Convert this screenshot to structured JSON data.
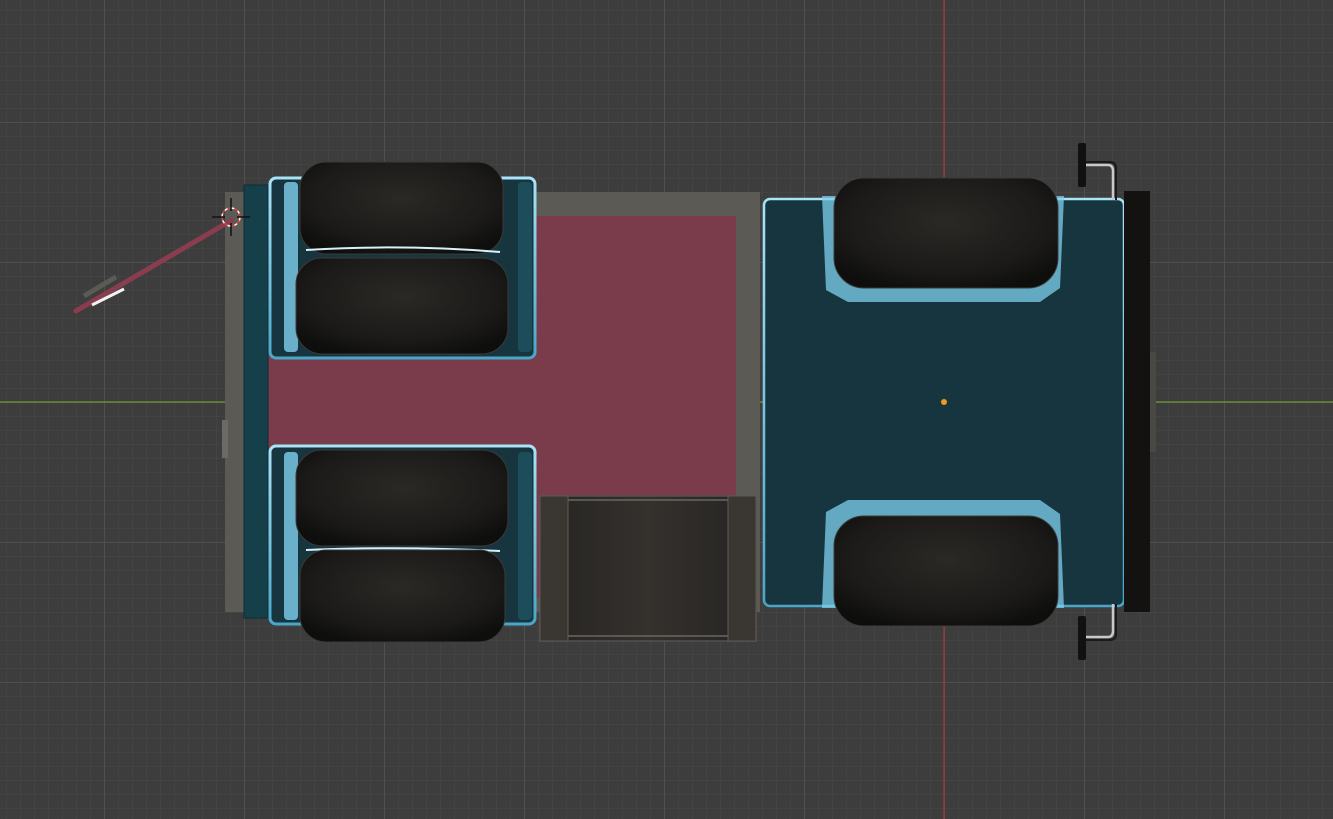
{
  "viewport": {
    "grid_color": "#505050",
    "background_color": "#3d3d3d",
    "x_axis_color": "#6f9a2c",
    "y_axis_color": "#b0323f"
  },
  "icons": {
    "cursor": "3d-cursor-icon",
    "origin": "object-origin-icon"
  },
  "colors": {
    "trailer_bed": "#7a3c4b",
    "trailer_frame": "#5c5a55",
    "tractor_body": "#16353f",
    "body_highlight": "#7fd0ef",
    "tire": "#1e1d1b",
    "tool_box": "#2f2c29",
    "bumper": "#141210",
    "origin_dot": "#f29a1f"
  }
}
